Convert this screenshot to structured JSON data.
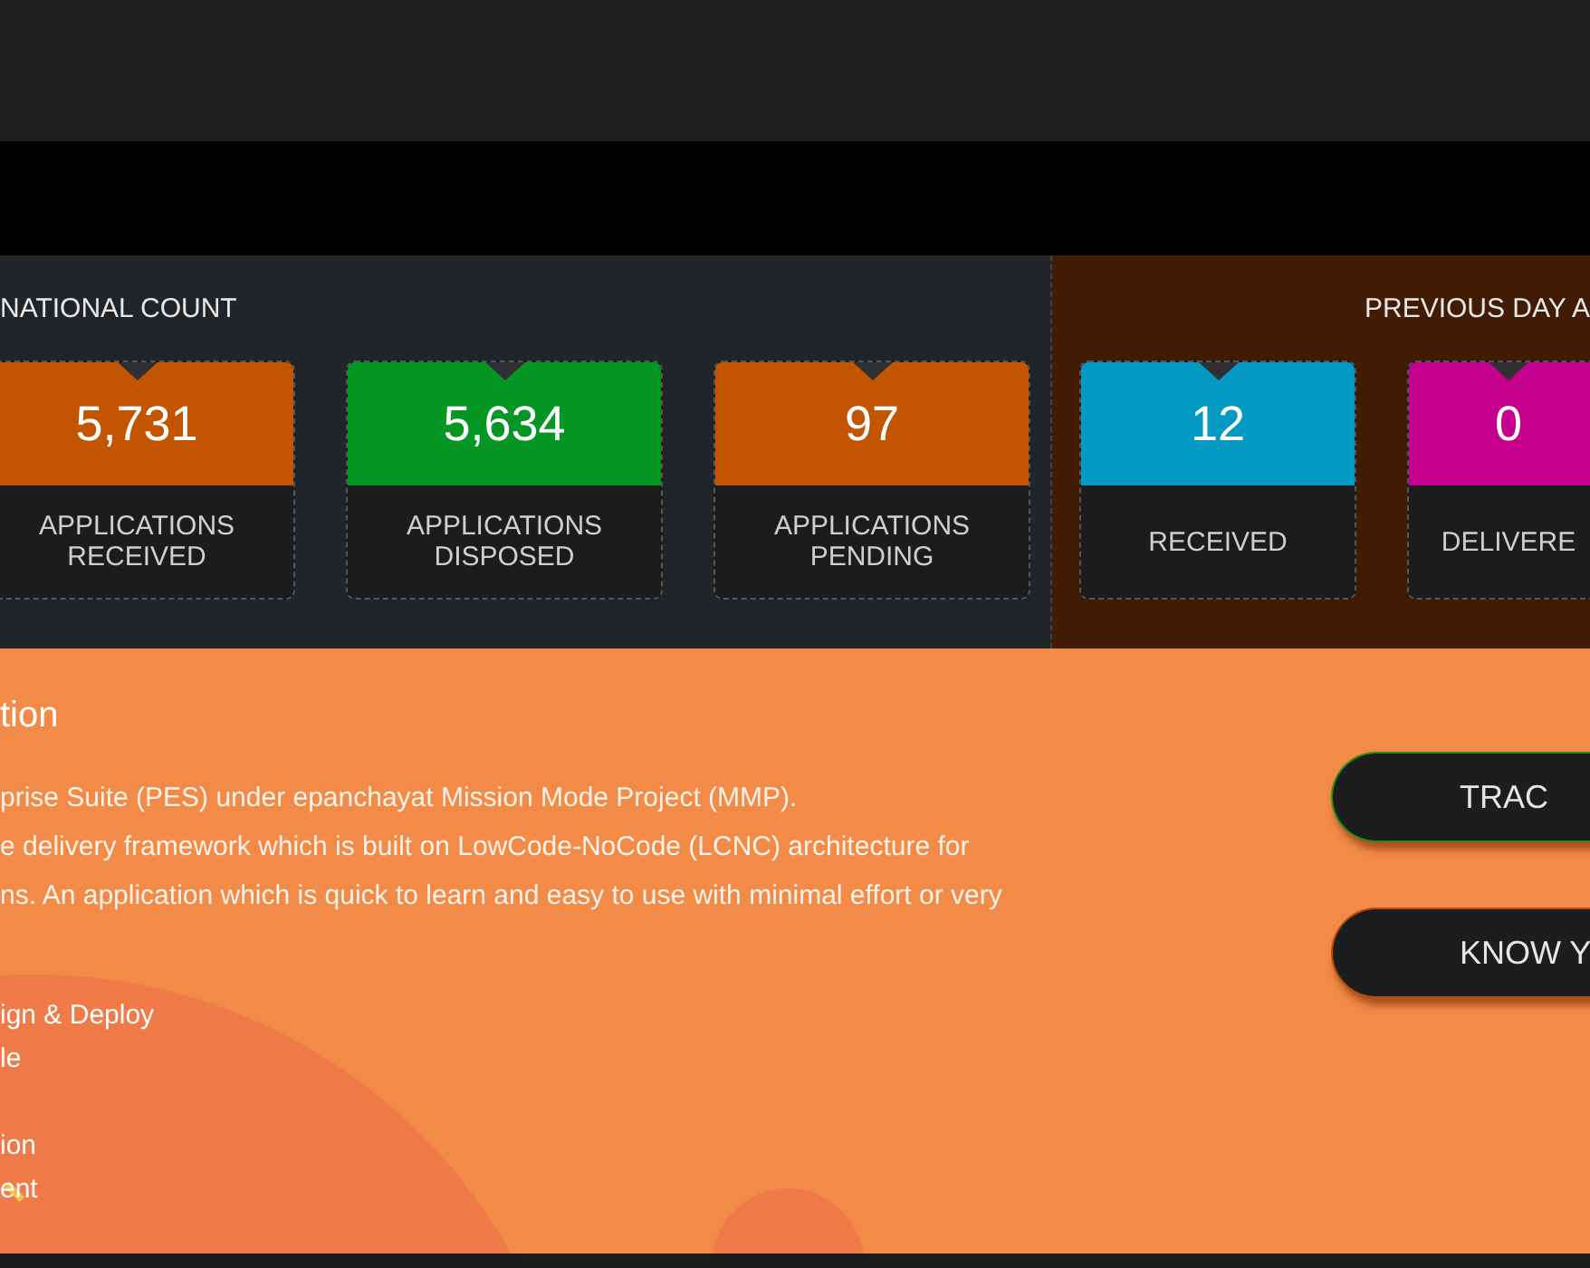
{
  "national_count": {
    "title": "NATIONAL COUNT",
    "cards": [
      {
        "value": "5,731",
        "label": "APPLICATIONS RECEIVED",
        "color": "#c45500"
      },
      {
        "value": "5,634",
        "label": "APPLICATIONS DISPOSED",
        "color": "#069623"
      },
      {
        "value": "97",
        "label": "APPLICATIONS PENDING",
        "color": "#c45500"
      }
    ]
  },
  "previous_day": {
    "title": "PREVIOUS DAY A",
    "cards": [
      {
        "value": "12",
        "label": "RECEIVED",
        "color": "#0399c2"
      },
      {
        "value": "0",
        "label": "DELIVERE",
        "color": "#c4008c"
      }
    ]
  },
  "about": {
    "title": "tion",
    "description_lines": [
      "prise Suite (PES) under epanchayat Mission Mode Project (MMP).",
      "e delivery framework which is built on LowCode-NoCode (LCNC) architecture for",
      "ns. An application which is quick to learn and easy to use with minimal effort or very"
    ],
    "feature_groups": [
      [
        "ign & Deploy",
        "le"
      ],
      [
        "ion",
        "ent"
      ]
    ],
    "buttons": [
      {
        "label": "TRAC",
        "kind": "track"
      },
      {
        "label": "KNOW Y",
        "kind": "know"
      }
    ]
  }
}
